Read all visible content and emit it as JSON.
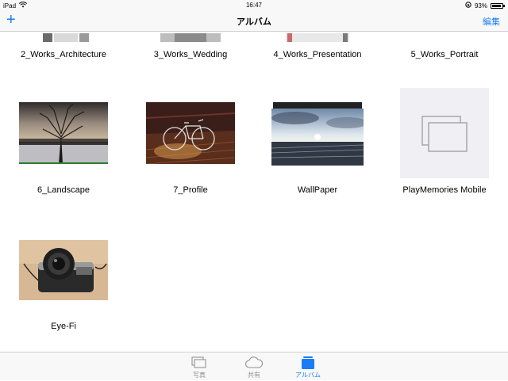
{
  "status_bar": {
    "device": "iPad",
    "time": "16:47",
    "battery_percent": 93,
    "battery_text": "93%"
  },
  "nav": {
    "add_icon": "plus-icon",
    "title": "アルバム",
    "edit_label": "編集"
  },
  "albums_top_row": [
    {
      "name": "2_Works_Architecture"
    },
    {
      "name": "3_Works_Wedding"
    },
    {
      "name": "4_Works_Presentation"
    },
    {
      "name": "5_Works_Portrait"
    }
  ],
  "albums": [
    {
      "name": "6_Landscape",
      "thumbnail": "bare-tree-at-sunset"
    },
    {
      "name": "7_Profile",
      "thumbnail": "bicycle-on-wooden-deck"
    },
    {
      "name": "WallPaper",
      "thumbnail": "sunset-over-sea"
    },
    {
      "name": "PlayMemories Mobile",
      "thumbnail": "empty-album-placeholder"
    },
    {
      "name": "Eye-Fi",
      "thumbnail": "vintage-camera"
    }
  ],
  "tab_bar": {
    "tabs": [
      {
        "label": "写真",
        "icon": "photos-icon"
      },
      {
        "label": "共有",
        "icon": "cloud-icon"
      },
      {
        "label": "アルバム",
        "icon": "album-icon",
        "active": true
      }
    ]
  },
  "colors": {
    "accent": "#1a7cf6",
    "bar_bg": "#f8f8f8",
    "inactive_tab": "#929292",
    "placeholder_bg": "#efeff4"
  }
}
